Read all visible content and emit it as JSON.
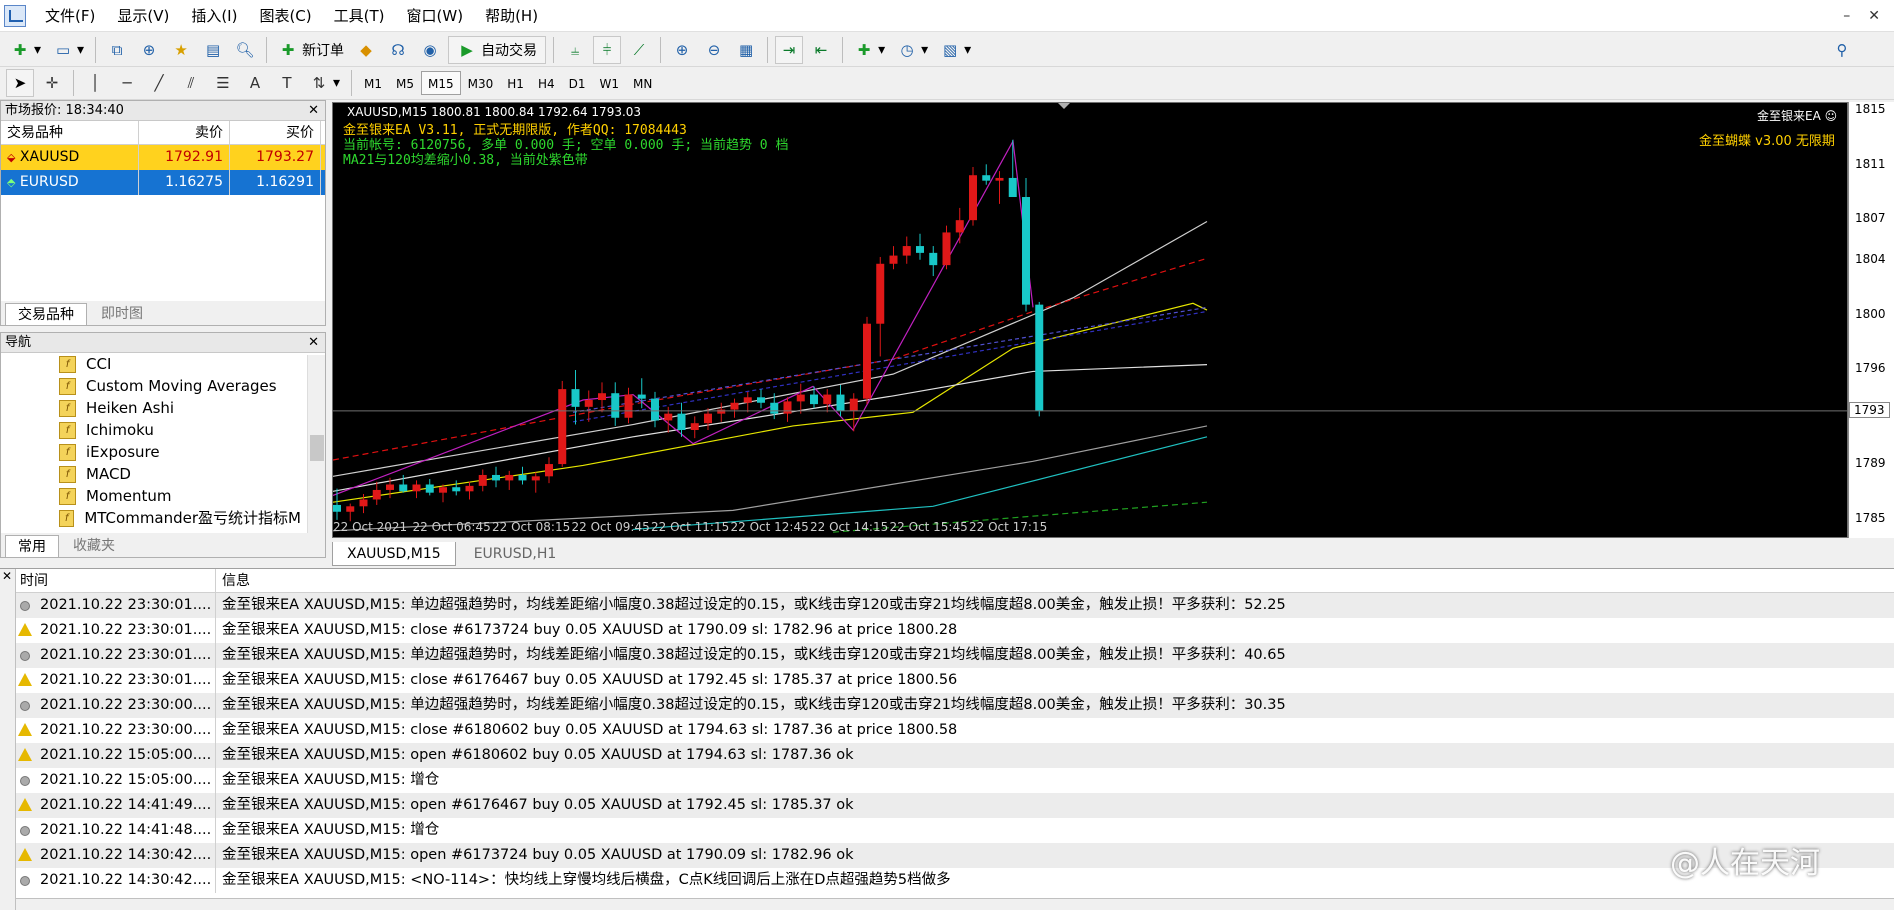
{
  "menu": [
    "文件(F)",
    "显示(V)",
    "插入(I)",
    "图表(C)",
    "工具(T)",
    "窗口(W)",
    "帮助(H)"
  ],
  "toolbar": {
    "new_order": "新订单",
    "auto_trade": "自动交易"
  },
  "timeframes": [
    "M1",
    "M5",
    "M15",
    "M30",
    "H1",
    "H4",
    "D1",
    "W1",
    "MN"
  ],
  "active_timeframe": "M15",
  "market_watch": {
    "title": "市场报价: 18:34:40",
    "columns": [
      "交易品种",
      "卖价",
      "买价"
    ],
    "rows": [
      {
        "symbol": "XAUUSD",
        "bid": "1792.91",
        "ask": "1793.27"
      },
      {
        "symbol": "EURUSD",
        "bid": "1.16275",
        "ask": "1.16291"
      }
    ],
    "tabs": [
      "交易品种",
      "即时图"
    ]
  },
  "navigator": {
    "title": "导航",
    "items": [
      "CCI",
      "Custom Moving Averages",
      "Heiken Ashi",
      "Ichimoku",
      "iExposure",
      "MACD",
      "Momentum",
      "MTCommander盈亏统计指标M"
    ],
    "tabs": [
      "常用",
      "收藏夹"
    ]
  },
  "chart": {
    "header": "XAUUSD,M15  1800.81 1800.84 1792.64 1793.03",
    "ea_line1": "金至银来EA V3.11, 正式无期限版, 作者QQ: 17084443",
    "ea_line2": "当前帐号: 6120756, 多单 0.000 手; 空单 0.000 手; 当前趋势 0 档",
    "ea_line3": "MA21与120均差缩小0.38, 当前处紫色带",
    "corner_name": "金至银来EA",
    "right_label": "金至蝴蝶 v3.00 无限期",
    "price_labels": [
      "1815",
      "1811",
      "1807",
      "1804",
      "1800",
      "1796",
      "1793",
      "1789",
      "1785"
    ],
    "current_price_label": "1793",
    "time_labels": [
      "22 Oct 2021",
      "22 Oct 06:45",
      "22 Oct 08:15",
      "22 Oct 09:45",
      "22 Oct 11:15",
      "22 Oct 12:45",
      "22 Oct 14:15",
      "22 Oct 15:45",
      "22 Oct 17:15"
    ],
    "tabs": [
      "XAUUSD,M15",
      "EURUSD,H1"
    ]
  },
  "journal": {
    "columns": [
      "时间",
      "信息"
    ],
    "rows": [
      {
        "type": "info",
        "time": "2021.10.22 23:30:01....",
        "msg": "金至银来EA XAUUSD,M15: 单边超强趋势时，均线差距缩小幅度0.38超过设定的0.15，或K线击穿120或击穿21均线幅度超8.00美金，触发止损！平多获利：52.25"
      },
      {
        "type": "warn",
        "time": "2021.10.22 23:30:01....",
        "msg": "金至银来EA XAUUSD,M15: close #6173724 buy 0.05 XAUUSD at 1790.09 sl: 1782.96 at price 1800.28"
      },
      {
        "type": "info",
        "time": "2021.10.22 23:30:01....",
        "msg": "金至银来EA XAUUSD,M15: 单边超强趋势时，均线差距缩小幅度0.38超过设定的0.15，或K线击穿120或击穿21均线幅度超8.00美金，触发止损！平多获利：40.65"
      },
      {
        "type": "warn",
        "time": "2021.10.22 23:30:01....",
        "msg": "金至银来EA XAUUSD,M15: close #6176467 buy 0.05 XAUUSD at 1792.45 sl: 1785.37 at price 1800.56"
      },
      {
        "type": "info",
        "time": "2021.10.22 23:30:00....",
        "msg": "金至银来EA XAUUSD,M15: 单边超强趋势时，均线差距缩小幅度0.38超过设定的0.15，或K线击穿120或击穿21均线幅度超8.00美金，触发止损！平多获利：30.35"
      },
      {
        "type": "warn",
        "time": "2021.10.22 23:30:00....",
        "msg": "金至银来EA XAUUSD,M15: close #6180602 buy 0.05 XAUUSD at 1794.63 sl: 1787.36 at price 1800.58"
      },
      {
        "type": "warn",
        "time": "2021.10.22 15:05:00....",
        "msg": "金至银来EA XAUUSD,M15: open #6180602 buy 0.05 XAUUSD at 1794.63 sl: 1787.36 ok"
      },
      {
        "type": "info",
        "time": "2021.10.22 15:05:00....",
        "msg": "金至银来EA XAUUSD,M15: 增仓"
      },
      {
        "type": "warn",
        "time": "2021.10.22 14:41:49....",
        "msg": "金至银来EA XAUUSD,M15: open #6176467 buy 0.05 XAUUSD at 1792.45 sl: 1785.37 ok"
      },
      {
        "type": "info",
        "time": "2021.10.22 14:41:48....",
        "msg": "金至银来EA XAUUSD,M15: 增仓"
      },
      {
        "type": "warn",
        "time": "2021.10.22 14:30:42....",
        "msg": "金至银来EA XAUUSD,M15: open #6173724 buy 0.05 XAUUSD at 1790.09 sl: 1782.96 ok"
      },
      {
        "type": "info",
        "time": "2021.10.22 14:30:42....",
        "msg": "金至银来EA XAUUSD,M15: <NO-114>：快均线上穿慢均线后横盘，C点K线回调后上涨在D点超强趋势5档做多"
      }
    ]
  },
  "watermark": "@人在天河",
  "candles": [
    [
      1786.1,
      1787.3,
      1785.0,
      1785.6
    ],
    [
      1785.6,
      1786.2,
      1784.9,
      1786.0
    ],
    [
      1786.0,
      1786.9,
      1785.5,
      1786.5
    ],
    [
      1786.5,
      1787.8,
      1786.1,
      1787.2
    ],
    [
      1787.2,
      1788.1,
      1786.6,
      1787.6
    ],
    [
      1787.6,
      1788.3,
      1787.0,
      1787.1
    ],
    [
      1787.1,
      1787.9,
      1786.6,
      1787.6
    ],
    [
      1787.6,
      1788.0,
      1786.8,
      1787.0
    ],
    [
      1787.0,
      1787.6,
      1786.3,
      1787.4
    ],
    [
      1787.4,
      1787.9,
      1786.8,
      1787.1
    ],
    [
      1787.1,
      1787.8,
      1786.5,
      1787.5
    ],
    [
      1787.5,
      1788.7,
      1787.1,
      1788.3
    ],
    [
      1788.3,
      1788.9,
      1787.4,
      1787.9
    ],
    [
      1787.9,
      1788.6,
      1787.2,
      1788.3
    ],
    [
      1788.3,
      1788.9,
      1787.6,
      1787.9
    ],
    [
      1787.9,
      1788.5,
      1787.0,
      1788.2
    ],
    [
      1788.2,
      1789.6,
      1787.7,
      1789.1
    ],
    [
      1789.1,
      1795.2,
      1788.9,
      1794.6
    ],
    [
      1794.6,
      1796.0,
      1792.0,
      1793.3
    ],
    [
      1793.3,
      1794.5,
      1792.2,
      1793.8
    ],
    [
      1793.8,
      1795.1,
      1792.9,
      1794.3
    ],
    [
      1794.3,
      1795.1,
      1791.9,
      1792.5
    ],
    [
      1792.5,
      1794.7,
      1792.1,
      1794.2
    ],
    [
      1794.2,
      1795.4,
      1793.2,
      1793.9
    ],
    [
      1793.9,
      1794.4,
      1791.8,
      1792.3
    ],
    [
      1792.3,
      1793.3,
      1791.4,
      1792.8
    ],
    [
      1792.8,
      1793.6,
      1791.1,
      1791.6
    ],
    [
      1791.6,
      1792.6,
      1791.0,
      1792.1
    ],
    [
      1792.1,
      1793.2,
      1791.6,
      1792.8
    ],
    [
      1792.8,
      1793.6,
      1792.2,
      1793.1
    ],
    [
      1793.1,
      1793.9,
      1792.5,
      1793.6
    ],
    [
      1793.6,
      1794.4,
      1792.9,
      1794.0
    ],
    [
      1794.0,
      1794.6,
      1793.2,
      1793.6
    ],
    [
      1793.6,
      1794.3,
      1792.4,
      1792.8
    ],
    [
      1792.8,
      1794.0,
      1792.2,
      1793.7
    ],
    [
      1793.7,
      1795.0,
      1792.8,
      1794.2
    ],
    [
      1794.2,
      1794.8,
      1793.2,
      1793.5
    ],
    [
      1793.5,
      1794.6,
      1792.9,
      1794.2
    ],
    [
      1794.2,
      1794.9,
      1792.6,
      1793.0
    ],
    [
      1793.0,
      1794.3,
      1791.5,
      1793.9
    ],
    [
      1793.9,
      1799.9,
      1793.5,
      1799.4
    ],
    [
      1799.4,
      1804.3,
      1797.0,
      1803.8
    ],
    [
      1803.8,
      1805.1,
      1803.4,
      1804.4
    ],
    [
      1804.4,
      1805.8,
      1803.8,
      1805.1
    ],
    [
      1805.1,
      1806.0,
      1804.1,
      1804.6
    ],
    [
      1804.6,
      1805.1,
      1802.9,
      1803.7
    ],
    [
      1803.7,
      1806.6,
      1803.4,
      1806.1
    ],
    [
      1806.1,
      1807.9,
      1805.3,
      1807.0
    ],
    [
      1807.0,
      1810.9,
      1806.6,
      1810.3
    ],
    [
      1810.3,
      1811.1,
      1809.6,
      1809.9
    ],
    [
      1809.9,
      1810.6,
      1808.2,
      1810.1
    ],
    [
      1810.1,
      1812.9,
      1808.7,
      1808.7
    ],
    [
      1808.7,
      1810.1,
      1800.3,
      1800.8
    ],
    [
      1800.8,
      1801.0,
      1792.6,
      1793.0
    ]
  ]
}
